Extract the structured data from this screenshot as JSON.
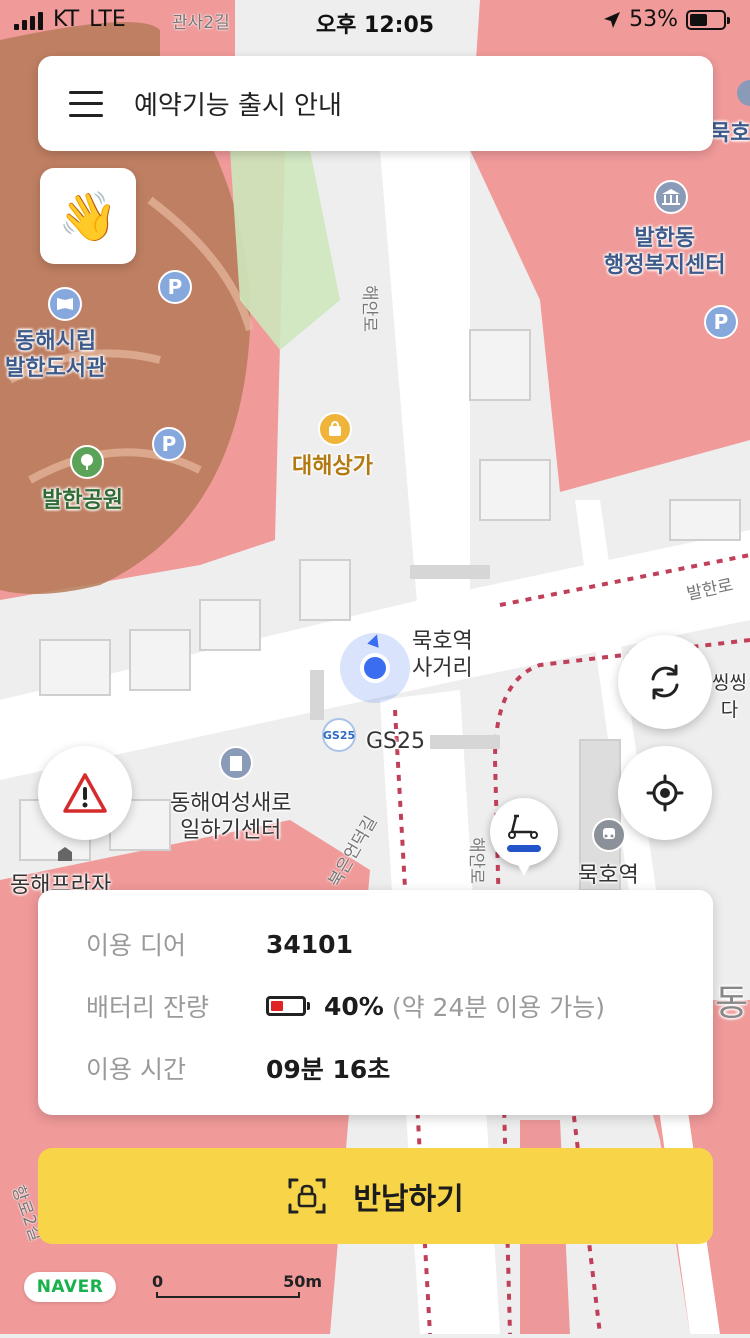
{
  "status_bar": {
    "carrier": "KT",
    "network": "LTE",
    "time": "오후 12:05",
    "battery_percent": "53%",
    "battery_level": 0.53
  },
  "top_bar": {
    "title": "예약기능 출시 안내"
  },
  "map": {
    "labels": {
      "library": "동해시립\n발한도서관",
      "park": "발한공원",
      "shop": "대해상가",
      "community_center": "발한동\n행정복지센터",
      "intersection": "묵호역\n사거리",
      "convenience_store": "GS25",
      "women_center": "동해여성새로\n일하기센터",
      "station": "묵호역",
      "plaza": "동해프라자",
      "top_right_partial": "묵호",
      "right_partial": "씽씽\n다",
      "far_right_partial": "동"
    },
    "roads": {
      "haean_ro_top": "해안로",
      "balhan_ro": "발한로",
      "haean_ro_bottom": "해안로",
      "bukeun_deok_gil": "북은언덕길",
      "gwansa_2gil": "관사2길",
      "hanggu_2gil": "항로2길"
    },
    "poi_glyphs": {
      "parking": "P",
      "convenience_badge": "GS25"
    }
  },
  "info_card": {
    "deer_label": "이용 디어",
    "deer_value": "34101",
    "battery_label": "배터리 잔량",
    "battery_value": "40%",
    "battery_note": "(약 24분 이용 가능)",
    "battery_level": 0.4,
    "time_label": "이용 시간",
    "time_value": "09분 16초"
  },
  "return_button": {
    "label": "반납하기"
  },
  "footer": {
    "logo": "NAVER",
    "scale_start": "0",
    "scale_end": "50m"
  },
  "colors": {
    "zone_red": "#ef8f8f",
    "park_brown": "#b07050",
    "accent_yellow": "#f8d548",
    "location_blue": "#3b6df0",
    "scooter_blue": "#2355c9",
    "warning_red": "#e02424",
    "naver_green": "#17b24b"
  },
  "icons": {
    "menu": "hamburger-menu-icon",
    "wave": "waving-hand-icon",
    "warning": "warning-triangle-icon",
    "refresh": "refresh-icon",
    "locate": "my-location-icon",
    "scooter": "kickboard-icon",
    "unlock": "qr-lock-icon"
  }
}
